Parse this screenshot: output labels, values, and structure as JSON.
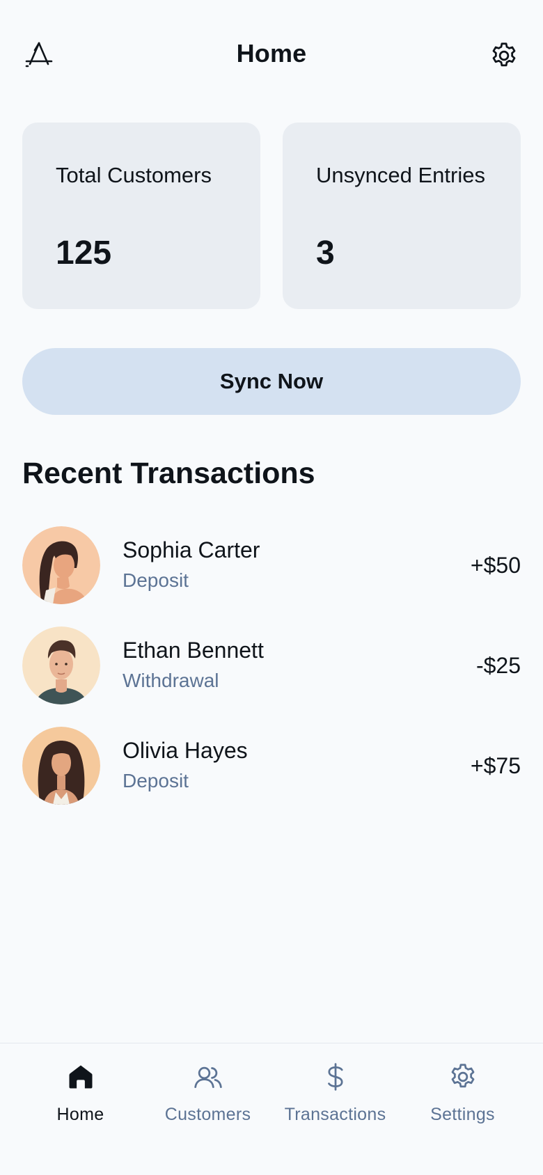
{
  "header": {
    "title": "Home",
    "left_icon": "app-store-icon",
    "right_icon": "gear-icon"
  },
  "stats": [
    {
      "label": "Total Customers",
      "value": "125"
    },
    {
      "label": "Unsynced Entries",
      "value": "3"
    }
  ],
  "sync_button": {
    "label": "Sync Now"
  },
  "recent": {
    "title": "Recent Transactions",
    "items": [
      {
        "name": "Sophia Carter",
        "type": "Deposit",
        "amount": "+$50"
      },
      {
        "name": "Ethan Bennett",
        "type": "Withdrawal",
        "amount": "-$25"
      },
      {
        "name": "Olivia Hayes",
        "type": "Deposit",
        "amount": "+$75"
      }
    ]
  },
  "bottom_nav": {
    "items": [
      {
        "label": "Home",
        "icon": "home-icon",
        "active": true
      },
      {
        "label": "Customers",
        "icon": "users-icon",
        "active": false
      },
      {
        "label": "Transactions",
        "icon": "dollar-icon",
        "active": false
      },
      {
        "label": "Settings",
        "icon": "gear-icon",
        "active": false
      }
    ]
  },
  "colors": {
    "background": "#f8fafc",
    "card": "#e9edf2",
    "button": "#d4e1f1",
    "text": "#0f141a",
    "muted": "#5c7394"
  }
}
